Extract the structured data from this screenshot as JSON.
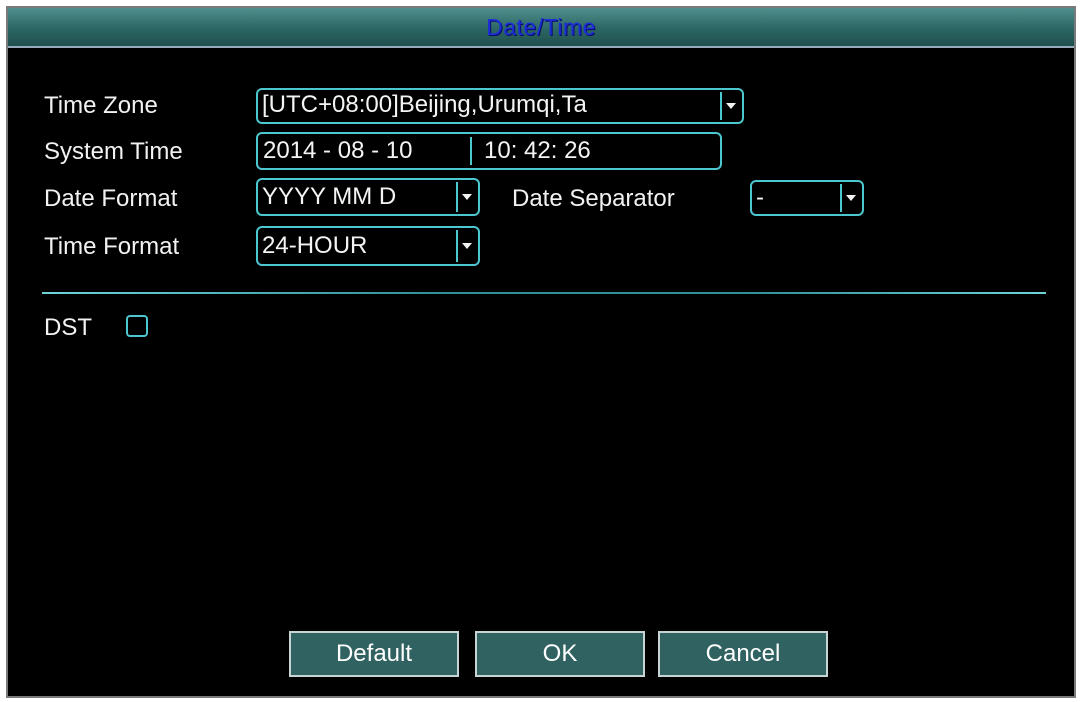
{
  "window": {
    "title": "Date/Time"
  },
  "fields": {
    "time_zone": {
      "label": "Time Zone",
      "value": "[UTC+08:00]Beijing,Urumqi,Ta"
    },
    "system_time": {
      "label": "System Time",
      "date": "2014 - 08 - 10",
      "time": "10: 42: 26"
    },
    "date_format": {
      "label": "Date Format",
      "value": "YYYY MM D"
    },
    "date_separator": {
      "label": "Date Separator",
      "value": "-"
    },
    "time_format": {
      "label": "Time Format",
      "value": "24-HOUR"
    }
  },
  "dst": {
    "label": "DST",
    "checked": false
  },
  "buttons": {
    "default": "Default",
    "ok": "OK",
    "cancel": "Cancel"
  },
  "colors": {
    "accent": "#4cc6cf",
    "title_bar": "#2c6664",
    "title_text": "#1b2fd6",
    "button_bg": "#2f6261"
  }
}
